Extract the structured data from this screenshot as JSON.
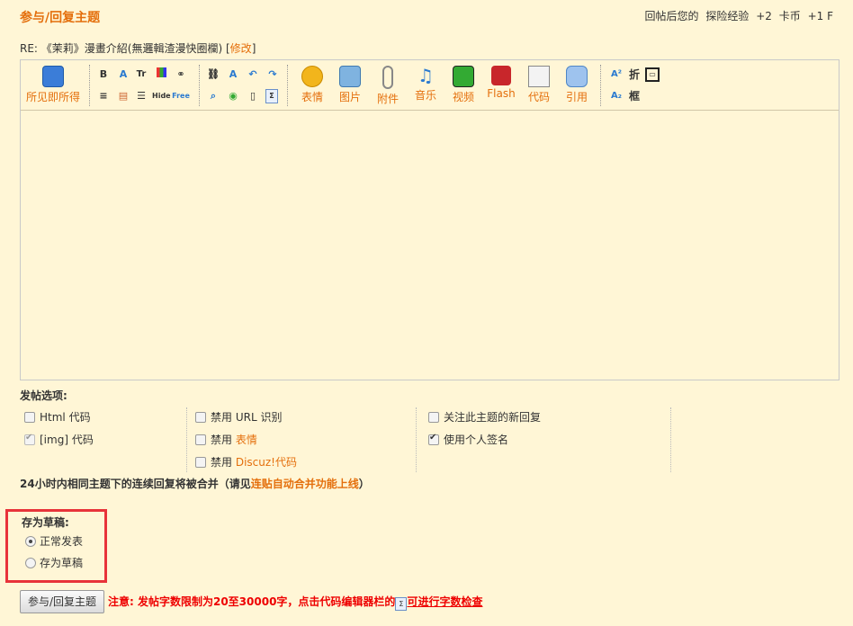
{
  "header": {
    "title": "参与/回复主题",
    "reward_prefix": "回帖后您的",
    "reward_1_label": "探险经验",
    "reward_1_value": "+2",
    "reward_2_label": "卡币",
    "reward_2_value": "+1 F"
  },
  "reply_to": {
    "prefix": "RE: 《茉莉》漫畫介紹(無邏輯渣漫快圈欄)",
    "bracket_open": "[",
    "edit_label": "修改",
    "bracket_close": "]"
  },
  "toolbar": {
    "wysiwyg_label": "所见即所得",
    "emoticon_label": "表情",
    "image_label": "图片",
    "attach_label": "附件",
    "music_label": "音乐",
    "video_label": "视频",
    "flash_label": "Flash",
    "code_label": "代码",
    "quote_label": "引用",
    "bold_glyph": "B",
    "font_glyph": "Tr",
    "hide_glyph": "Hide",
    "free_glyph": "Free",
    "fold_label": "折",
    "frame_label": "框",
    "sup_glyph": "A²",
    "sub_glyph": "A₂"
  },
  "options": {
    "title": "发帖选项:",
    "html_code": "Html 代码",
    "img_code": "[img] 代码",
    "disable_url_prefix": "禁用",
    "disable_url_suffix": "URL 识别",
    "disable_emoticon_prefix": "禁用",
    "disable_emoticon_link": "表情",
    "disable_discuz_prefix": "禁用",
    "disable_discuz_link": "Discuz!代码",
    "follow_replies": "关注此主题的新回复",
    "use_signature": "使用个人签名"
  },
  "merge_note": {
    "text": "24小时内相同主题下的连续回复将被合并（请见",
    "link": "连贴自动合并功能上线",
    "close": "）"
  },
  "draft": {
    "title": "存为草稿:",
    "normal_label": "正常发表",
    "draft_label": "存为草稿",
    "selected": "正常发表"
  },
  "submit": {
    "button_label": "参与/回复主题",
    "notice_text": "注意: 发帖字数限制为20至30000字，点击代码编辑器栏的",
    "notice_icon": "Σ",
    "notice_tail": "可进行字数检查"
  },
  "colors": {
    "accent": "#e46f0c",
    "background": "#fff6d6",
    "highlight_box": "#e8333a",
    "warning_text": "#ee0000"
  }
}
